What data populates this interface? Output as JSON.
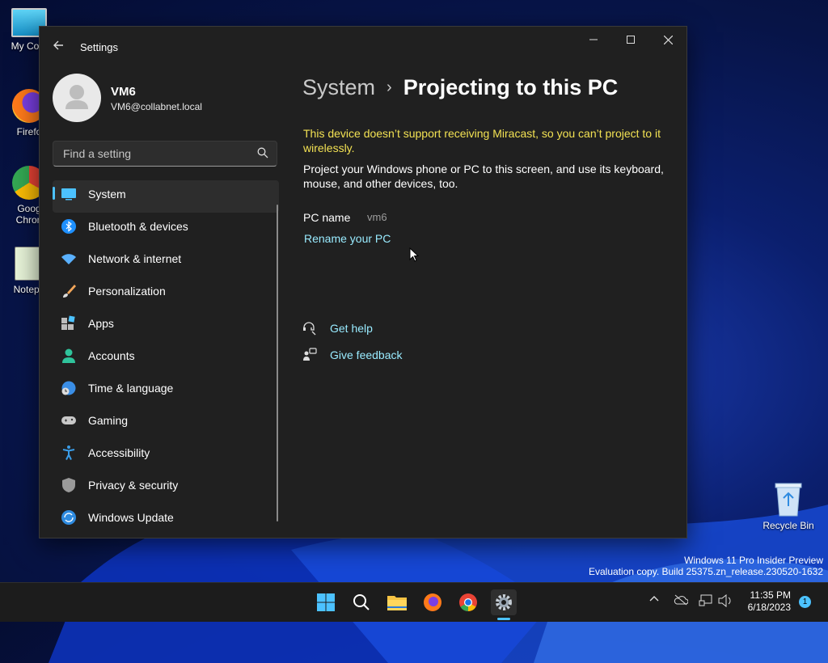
{
  "desktop": {
    "icons": [
      {
        "label": "My Com"
      },
      {
        "label": "Firefo"
      },
      {
        "label": "Goog\nChron"
      },
      {
        "label": "Notepa"
      }
    ],
    "recycle_bin": "Recycle Bin",
    "watermark_line1": "Windows 11 Pro Insider Preview",
    "watermark_line2": "Evaluation copy. Build 25375.zn_release.230520-1632"
  },
  "window": {
    "title": "Settings",
    "user": {
      "name": "VM6",
      "email": "VM6@collabnet.local"
    },
    "search": {
      "placeholder": "Find a setting"
    },
    "nav": [
      {
        "label": "System",
        "icon": "system-icon",
        "active": true
      },
      {
        "label": "Bluetooth & devices",
        "icon": "bluetooth-icon"
      },
      {
        "label": "Network & internet",
        "icon": "wifi-icon"
      },
      {
        "label": "Personalization",
        "icon": "brush-icon"
      },
      {
        "label": "Apps",
        "icon": "apps-icon"
      },
      {
        "label": "Accounts",
        "icon": "person-icon"
      },
      {
        "label": "Time & language",
        "icon": "globe-clock-icon"
      },
      {
        "label": "Gaming",
        "icon": "gamepad-icon"
      },
      {
        "label": "Accessibility",
        "icon": "accessibility-icon"
      },
      {
        "label": "Privacy & security",
        "icon": "shield-icon"
      },
      {
        "label": "Windows Update",
        "icon": "update-icon"
      }
    ],
    "breadcrumb": {
      "parent": "System",
      "separator": "›",
      "current": "Projecting to this PC"
    },
    "warning": "This device doesn’t support receiving Miracast, so you can’t project to it wirelessly.",
    "description": "Project your Windows phone or PC to this screen, and use its keyboard, mouse, and other devices, too.",
    "pc_name_label": "PC name",
    "pc_name_value": "vm6",
    "rename_link": "Rename your PC",
    "help_links": [
      {
        "label": "Get help",
        "icon": "help-icon"
      },
      {
        "label": "Give feedback",
        "icon": "feedback-icon"
      }
    ]
  },
  "taskbar": {
    "time": "11:35 PM",
    "date": "6/18/2023",
    "notification_count": "1"
  },
  "colors": {
    "accent": "#4cc2ff",
    "link": "#99ebff",
    "warning": "#f3e253",
    "window_bg": "#202020"
  }
}
